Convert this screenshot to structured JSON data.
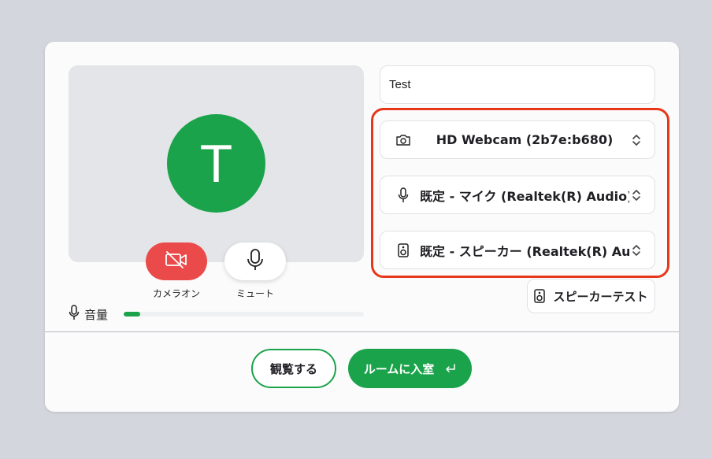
{
  "preview": {
    "avatar_initial": "T",
    "camera_label": "カメラオン",
    "mic_label": "ミュート",
    "volume_label": "音量",
    "volume_level": 0.07
  },
  "name_input": {
    "value": "Test"
  },
  "devices": {
    "camera": "HD Webcam (2b7e:b680)",
    "microphone": "既定 - マイク (Realtek(R) Audio)",
    "speaker": "既定 - スピーカー (Realtek(R) Audio)"
  },
  "speaker_test_label": "スピーカーテスト",
  "actions": {
    "watch_label": "観覧する",
    "join_label": "ルームに入室"
  },
  "colors": {
    "accent": "#1aa34a",
    "camera_off": "#ea4a4a",
    "highlight": "#e8361a"
  }
}
